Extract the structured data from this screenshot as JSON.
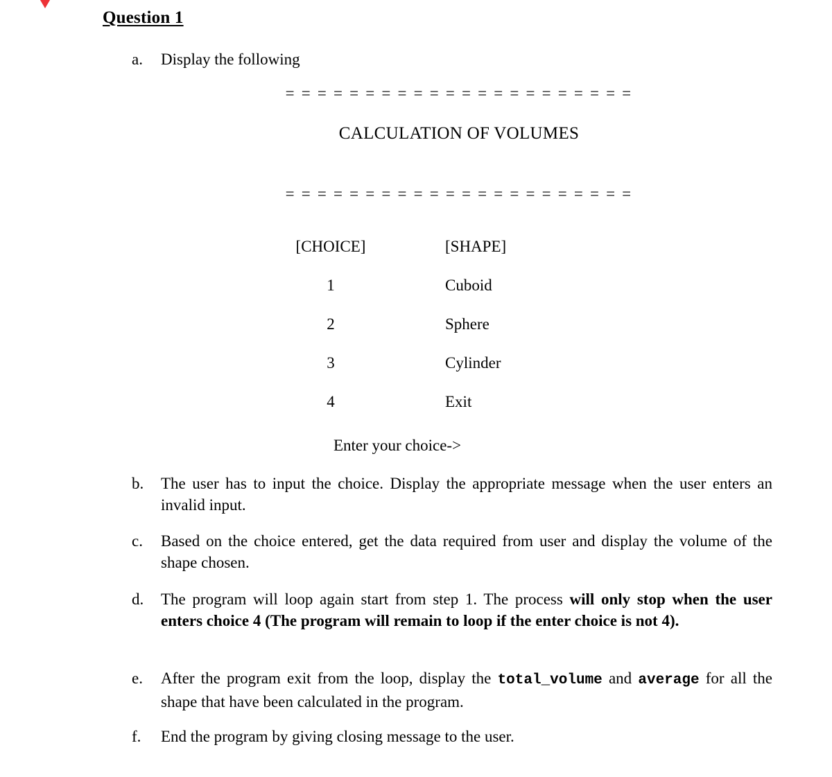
{
  "document": {
    "title": "Question 1",
    "marker_color": "#ed3237"
  },
  "console": {
    "divider": "= = = = = = = = = = = = = = = = = = = = = =",
    "heading": "CALCULATION OF VOLUMES",
    "columns": [
      "[CHOICE]",
      "[SHAPE]"
    ],
    "rows": [
      {
        "choice": "1",
        "shape": "Cuboid"
      },
      {
        "choice": "2",
        "shape": "Sphere"
      },
      {
        "choice": "3",
        "shape": "Cylinder"
      },
      {
        "choice": "4",
        "shape": "Exit"
      }
    ],
    "prompt": "Enter your choice->"
  },
  "items": [
    {
      "letter": "a.",
      "text": "Display the following"
    },
    {
      "letter": "b.",
      "text": "The user has to input the choice. Display the appropriate message when the user enters an invalid input."
    },
    {
      "letter": "c.",
      "text": "Based on the choice entered, get the data required from user and display the volume of the shape chosen."
    },
    {
      "letter": "d.",
      "text_plain": "The program will loop again start from step 1. The process ",
      "text_bold": "will only stop when the user enters choice 4 (The program will remain to loop if the enter choice is not 4)."
    },
    {
      "letter": "e.",
      "text_1": "After the program exit from the loop, display the ",
      "code_1": "total_volume",
      "text_2": " and ",
      "code_2": "average",
      "text_3": " for all the shape that have been calculated in the program."
    },
    {
      "letter": "f.",
      "text": "End the program by giving closing message to the user."
    }
  ]
}
